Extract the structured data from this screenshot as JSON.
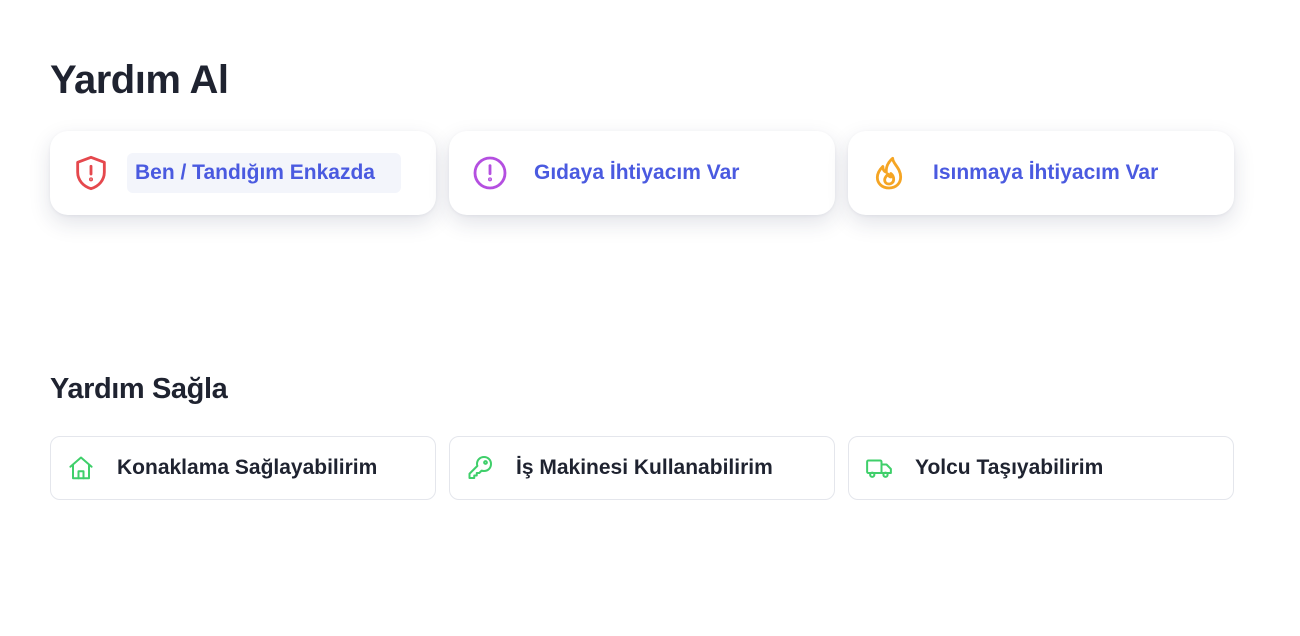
{
  "header": {
    "title": "Yardım Al"
  },
  "need_help": {
    "items": [
      {
        "label": "Ben / Tandığım Enkazda",
        "icon": "shield-alert-icon",
        "color": "#e5484d"
      },
      {
        "label": "Gıdaya İhtiyacım Var",
        "icon": "alert-circle-icon",
        "color": "#b44fe0"
      },
      {
        "label": "Isınmaya İhtiyacım Var",
        "icon": "flame-icon",
        "color": "#f5a524"
      }
    ]
  },
  "give_help": {
    "title": "Yardım Sağla",
    "items": [
      {
        "label": "Konaklama Sağlayabilirim",
        "icon": "home-icon",
        "color": "#3fcf6a"
      },
      {
        "label": "İş Makinesi Kullanabilirim",
        "icon": "key-icon",
        "color": "#3fcf6a"
      },
      {
        "label": "Yolcu Taşıyabilirim",
        "icon": "truck-icon",
        "color": "#3fcf6a"
      }
    ]
  },
  "colors": {
    "accent_text": "#4a5ae0",
    "heading": "#1f2330"
  }
}
